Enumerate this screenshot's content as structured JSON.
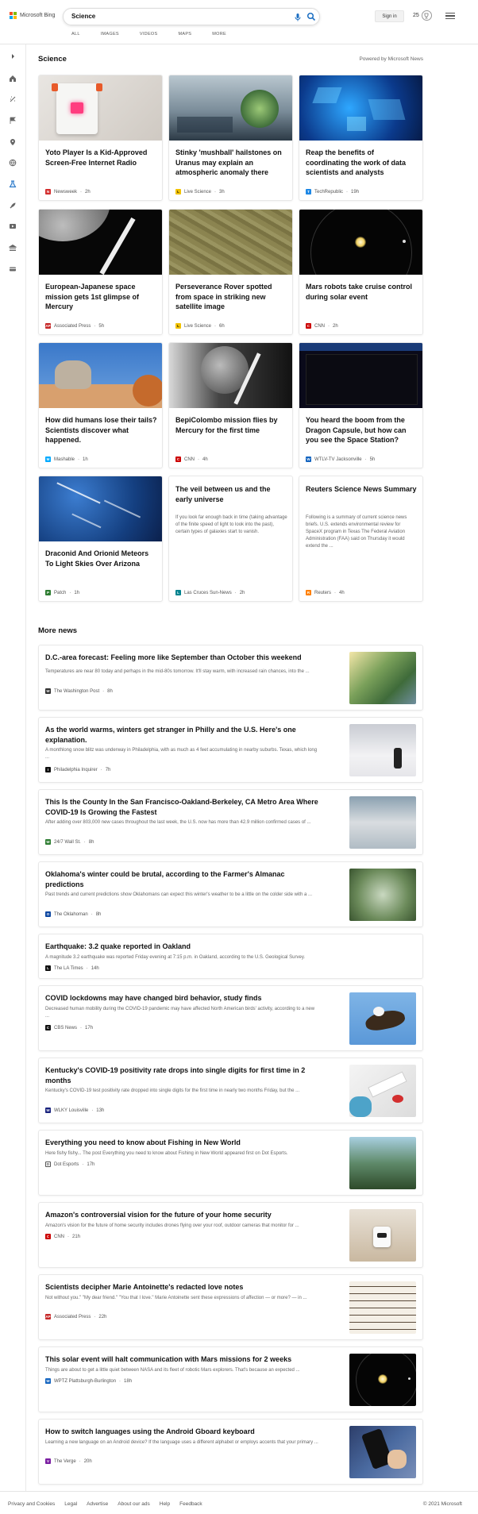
{
  "header": {
    "logo_text": "Microsoft Bing",
    "query": "Science",
    "signin": "Sign in",
    "reward_points": "25",
    "tabs": [
      "ALL",
      "IMAGES",
      "VIDEOS",
      "MAPS",
      "MORE"
    ]
  },
  "section": {
    "title": "Science",
    "powered": "Powered by Microsoft News"
  },
  "cards": [
    {
      "title": "Yoto Player Is a Kid-Approved Screen-Free Internet Radio",
      "source": "Newsweek",
      "time": "2h",
      "icon_color": "#d32f2f",
      "icon_letter": "N"
    },
    {
      "title": "Stinky 'mushball' hailstones on Uranus may explain an atmospheric anomaly there",
      "source": "Live Science",
      "time": "3h",
      "icon_color": "#f2c200",
      "icon_letter": "L"
    },
    {
      "title": "Reap the benefits of coordinating the work of data scientists and analysts",
      "source": "TechRepublic",
      "time": "19h",
      "icon_color": "#1e88e5",
      "icon_letter": "T"
    },
    {
      "title": "European-Japanese space mission gets 1st glimpse of Mercury",
      "source": "Associated Press",
      "time": "5h",
      "icon_color": "#c62828",
      "icon_letter": "AP"
    },
    {
      "title": "Perseverance Rover spotted from space in striking new satellite image",
      "source": "Live Science",
      "time": "6h",
      "icon_color": "#f2c200",
      "icon_letter": "L"
    },
    {
      "title": "Mars robots take cruise control during solar event",
      "source": "CNN",
      "time": "2h",
      "icon_color": "#cc0000",
      "icon_letter": "C"
    },
    {
      "title": "How did humans lose their tails? Scientists discover what happened.",
      "source": "Mashable",
      "time": "1h",
      "icon_color": "#00aaff",
      "icon_letter": "M"
    },
    {
      "title": "BepiColombo mission flies by Mercury for the first time",
      "source": "CNN",
      "time": "4h",
      "icon_color": "#cc0000",
      "icon_letter": "C"
    },
    {
      "title": "You heard the boom from the Dragon Capsule, but how can you see the Space Station?",
      "source": "WTLV-TV Jacksonville",
      "time": "5h",
      "icon_color": "#1565c0",
      "icon_letter": "W"
    },
    {
      "title": "Draconid And Orionid Meteors To Light Skies Over Arizona",
      "source": "Patch",
      "time": "1h",
      "icon_color": "#2e7d32",
      "icon_letter": "P"
    },
    {
      "title": "The veil between us and the early universe",
      "snippet": "If you look far enough back in time (taking advantage of the finite speed of light to look into the past), certain types of galaxies start to vanish.",
      "source": "Las Cruces Sun-News",
      "time": "2h",
      "icon_color": "#00838f",
      "icon_letter": "L"
    },
    {
      "title": "Reuters Science News Summary",
      "snippet": "Following is a summary of current science news briefs. U.S. extends environmental review for SpaceX program in Texas The Federal Aviation Administration (FAA) said on Thursday it would extend the ...",
      "source": "Reuters",
      "time": "4h",
      "icon_color": "#ff8000",
      "icon_letter": "R"
    }
  ],
  "more_news": {
    "title": "More news",
    "items": [
      {
        "title": "D.C.-area forecast: Feeling more like September than October this weekend",
        "snippet": "Temperatures are near 80 today and perhaps in the mid-80s tomorrow. It'll stay warm, with increased rain chances, into the ...",
        "source": "The Washington Post",
        "time": "8h",
        "icon_color": "#333",
        "icon_letter": "W"
      },
      {
        "title": "As the world warms, winters get stranger in Philly and the U.S. Here's one explanation.",
        "snippet": "A monthlong snow blitz was underway in Philadelphia, with as much as 4 feet accumulating in nearby suburbs. Texas, which long ...",
        "source": "Philadelphia Inquirer",
        "time": "7h",
        "icon_color": "#111",
        "icon_letter": "I"
      },
      {
        "title": "This Is the County In the San Francisco-Oakland-Berkeley, CA Metro Area Where COVID-19 Is Growing the Fastest",
        "snippet": "After adding over 803,000 new cases throughout the last week, the U.S. now has more than 42.9 million confirmed cases of ...",
        "source": "24/7 Wall St.",
        "time": "8h",
        "icon_color": "#2e7d32",
        "icon_letter": "W"
      },
      {
        "title": "Oklahoma's winter could be brutal, according to the Farmer's Almanac predictions",
        "snippet": "Past trends and current predictions show Oklahomans can expect this winter's weather to be a little on the colder side with a ...",
        "source": "The Oklahoman",
        "time": "8h",
        "icon_color": "#0d47a1",
        "icon_letter": "O"
      },
      {
        "title": "Earthquake: 3.2 quake reported in Oakland",
        "snippet": "A magnitude 3.2 earthquake was reported Friday evening at 7:15 p.m. in Oakland, according to the U.S. Geological Survey.",
        "source": "The LA Times",
        "time": "14h",
        "icon_color": "#111",
        "icon_letter": "L"
      },
      {
        "title": "COVID lockdowns may have changed bird behavior, study finds",
        "snippet": "Decreased human mobility during the COVID-19 pandemic may have affected North American birds' activity, according to a new ...",
        "source": "CBS News",
        "time": "17h",
        "icon_color": "#111",
        "icon_letter": "C"
      },
      {
        "title": "Kentucky's COVID-19 positivity rate drops into single digits for first time in 2 months",
        "snippet": "Kentucky's COVID-19 test positivity rate dropped into single digits for the first time in nearly two months Friday, but the ...",
        "source": "WLKY Louisville",
        "time": "13h",
        "icon_color": "#1a237e",
        "icon_letter": "W"
      },
      {
        "title": "Everything you need to know about Fishing in New World",
        "snippet": "Here fishy fishy... The post Everything you need to know about Fishing in New World appeared first on Dot Esports.",
        "source": "Dot Esports",
        "time": "17h",
        "icon_color": "#555",
        "icon_letter": "D"
      },
      {
        "title": "Amazon's controversial vision for the future of your home security",
        "snippet": "Amazon's vision for the future of home security includes drones flying over your roof, outdoor cameras that monitor for ...",
        "source": "CNN",
        "time": "21h",
        "icon_color": "#cc0000",
        "icon_letter": "C"
      },
      {
        "title": "Scientists decipher Marie Antoinette's redacted love notes",
        "snippet": "Not without you.\" \"My dear friend.\" \"You that I love.\" Marie Antoinette sent these expressions of affection — or more? — in ...",
        "source": "Associated Press",
        "time": "22h",
        "icon_color": "#c62828",
        "icon_letter": "AP"
      },
      {
        "title": "This solar event will halt communication with Mars missions for 2 weeks",
        "snippet": "Things are about to get a little quiet between NASA and its fleet of robotic Mars explorers. That's because an expected ...",
        "source": "WPTZ Plattsburgh-Burlington",
        "time": "18h",
        "icon_color": "#1565c0",
        "icon_letter": "W"
      },
      {
        "title": "How to switch languages using the Android Gboard keyboard",
        "snippet": "Learning a new language on an Android device? If the language uses a different alphabet or employs accents that your primary ...",
        "source": "The Verge",
        "time": "20h",
        "icon_color": "#7b1fa2",
        "icon_letter": "V"
      }
    ]
  },
  "footer": {
    "links": [
      "Privacy and Cookies",
      "Legal",
      "Advertise",
      "About our ads",
      "Help",
      "Feedback"
    ],
    "copyright": "© 2021 Microsoft"
  }
}
